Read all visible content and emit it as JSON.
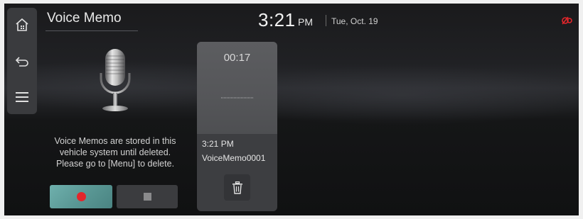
{
  "app": {
    "title": "Voice Memo"
  },
  "status_bar": {
    "time": "3:21",
    "ampm": "PM",
    "date": "Tue, Oct. 19"
  },
  "sidebar": {
    "items": [
      {
        "icon": "home-icon"
      },
      {
        "icon": "back-icon"
      },
      {
        "icon": "menu-icon"
      }
    ]
  },
  "main": {
    "info_message_lines": [
      "Voice Memos are stored in this",
      "vehicle system until deleted.",
      "Please go to [Menu] to delete."
    ],
    "record_button": {
      "icon": "record-icon"
    },
    "stop_button": {
      "icon": "stop-icon"
    }
  },
  "memo_card": {
    "duration": "00:17",
    "recorded_time": "3:21 PM",
    "name": "VoiceMemo0001",
    "delete_icon": "trash-icon"
  },
  "colors": {
    "record_accent": "#e3262b",
    "record_button_bg": "#5a9895",
    "status_icon": "#e3262b"
  }
}
